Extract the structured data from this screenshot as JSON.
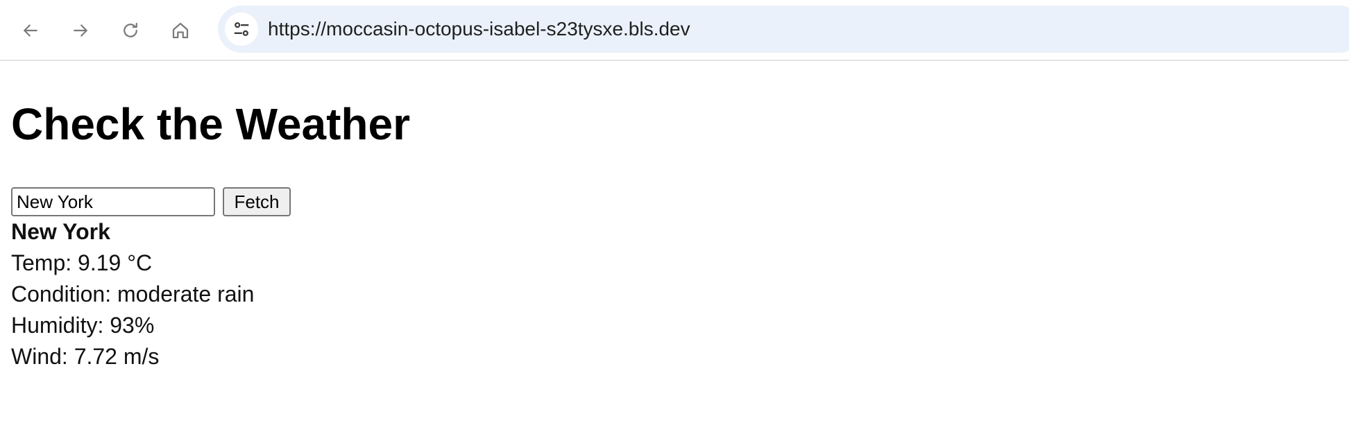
{
  "browser": {
    "url": "https://moccasin-octopus-isabel-s23tysxe.bls.dev",
    "icons": {
      "back": "arrow-left-icon",
      "forward": "arrow-right-icon",
      "reload": "reload-icon",
      "home": "home-icon",
      "site_info": "tune-icon"
    }
  },
  "page": {
    "title": "Check the Weather",
    "search": {
      "value": "New York",
      "button_label": "Fetch"
    },
    "result": {
      "city": "New York",
      "temp": "Temp: 9.19 °C",
      "condition": "Condition: moderate rain",
      "humidity": "Humidity: 93%",
      "wind": "Wind: 7.72 m/s"
    }
  },
  "colors": {
    "omnibox_bg": "#eaf1fa",
    "nav_icon": "#7a7a7a"
  }
}
